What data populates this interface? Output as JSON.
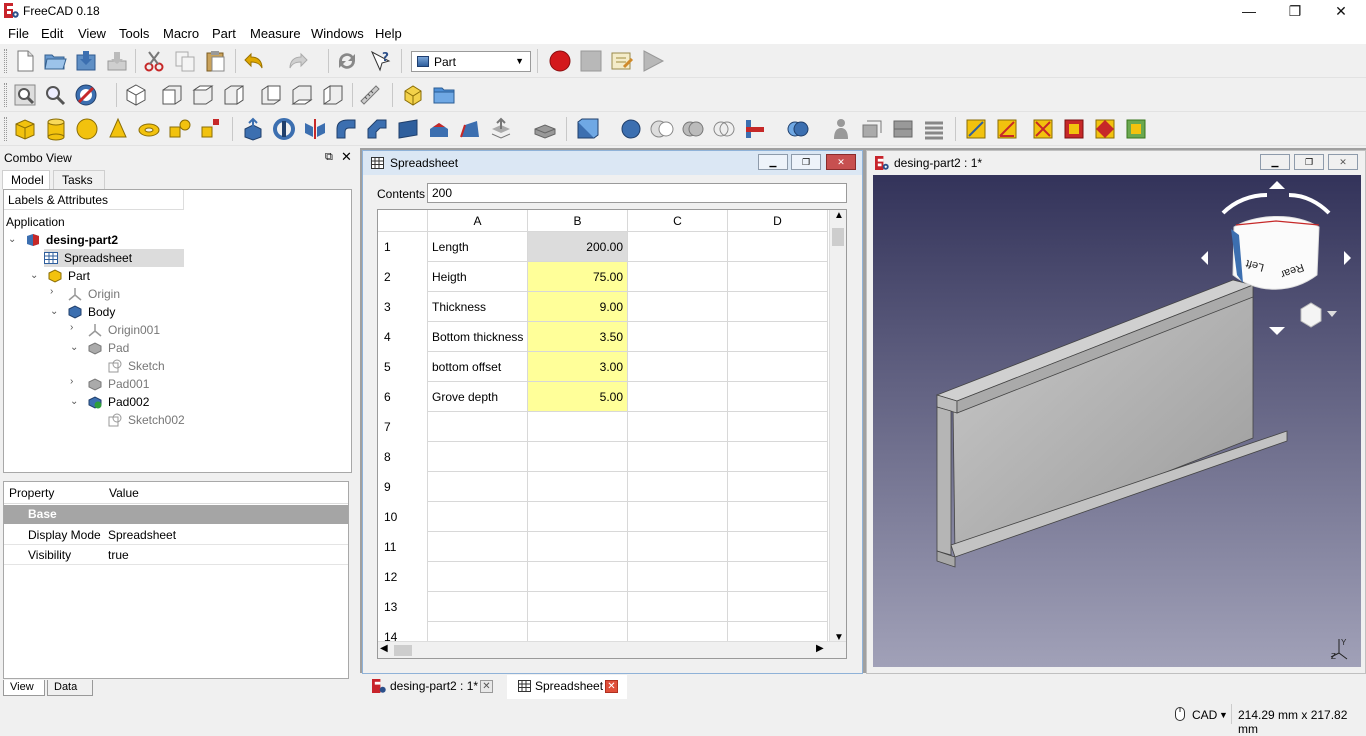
{
  "window": {
    "title": "FreeCAD 0.18",
    "min": "—",
    "max": "❐",
    "close": "✕"
  },
  "menu": [
    "File",
    "Edit",
    "View",
    "Tools",
    "Macro",
    "Part",
    "Measure",
    "Windows",
    "Help"
  ],
  "workbench": {
    "selected": "Part"
  },
  "combo": {
    "title": "Combo View",
    "tabs": [
      "Model",
      "Tasks"
    ],
    "tree_header": "Labels & Attributes",
    "tree": {
      "root": "Application",
      "doc": "desing-part2",
      "spreadsheet": "Spreadsheet",
      "part": "Part",
      "origin": "Origin",
      "body": "Body",
      "origin001": "Origin001",
      "pad": "Pad",
      "sketch": "Sketch",
      "pad001": "Pad001",
      "pad002": "Pad002",
      "sketch002": "Sketch002"
    },
    "props": {
      "col_property": "Property",
      "col_value": "Value",
      "group": "Base",
      "rows": [
        {
          "name": "Display Mode",
          "value": "Spreadsheet"
        },
        {
          "name": "Visibility",
          "value": "true"
        }
      ]
    },
    "bottom_tabs": [
      "View",
      "Data"
    ]
  },
  "spreadsheet": {
    "title": "Spreadsheet",
    "contents_label": "Contents",
    "contents_value": "200",
    "columns": [
      "A",
      "B",
      "C",
      "D"
    ],
    "rows": [
      {
        "n": "1",
        "a": "Length",
        "b": "200.00"
      },
      {
        "n": "2",
        "a": "Heigth",
        "b": "75.00"
      },
      {
        "n": "3",
        "a": "Thickness",
        "b": "9.00"
      },
      {
        "n": "4",
        "a": "Bottom thickness",
        "b": "3.50"
      },
      {
        "n": "5",
        "a": "bottom offset",
        "b": "3.00"
      },
      {
        "n": "6",
        "a": "Grove depth",
        "b": "5.00"
      },
      {
        "n": "7",
        "a": "",
        "b": ""
      },
      {
        "n": "8",
        "a": "",
        "b": ""
      },
      {
        "n": "9",
        "a": "",
        "b": ""
      },
      {
        "n": "10",
        "a": "",
        "b": ""
      },
      {
        "n": "11",
        "a": "",
        "b": ""
      },
      {
        "n": "12",
        "a": "",
        "b": ""
      },
      {
        "n": "13",
        "a": "",
        "b": ""
      },
      {
        "n": "14",
        "a": "",
        "b": ""
      }
    ]
  },
  "view3d": {
    "title": "desing-part2 : 1*",
    "navcube_left": "Left",
    "navcube_rear": "Rear"
  },
  "doctabs": [
    {
      "label": "desing-part2 : 1*"
    },
    {
      "label": "Spreadsheet"
    }
  ],
  "status": {
    "unit": "CAD",
    "dims": "214.29 mm x 217.82 mm"
  },
  "colors": {
    "accent_yellow": "#ffff99",
    "selection": "#dcdcdc",
    "view_top": "#33335a",
    "view_bottom": "#a1a1b8"
  }
}
